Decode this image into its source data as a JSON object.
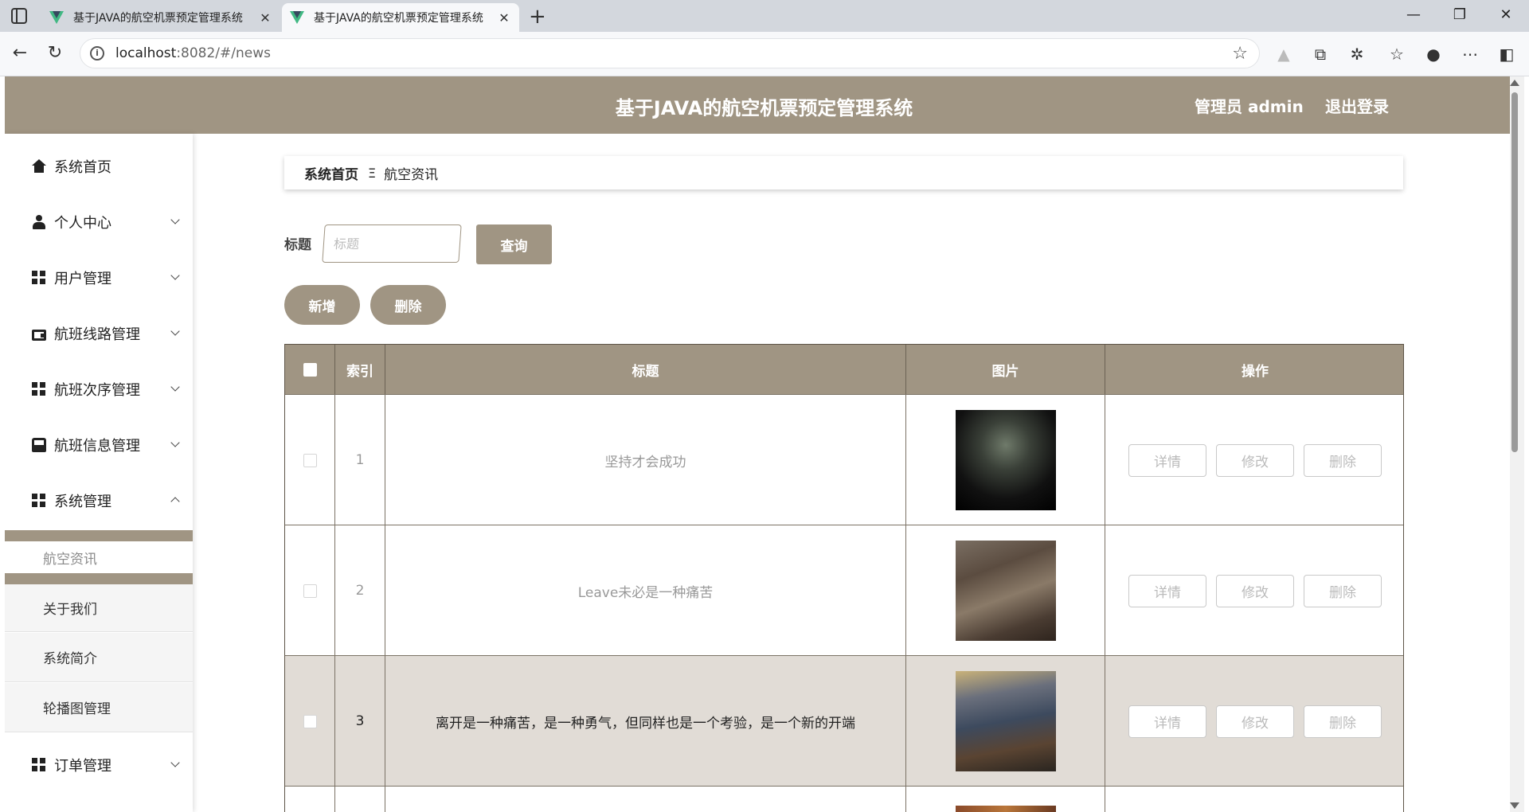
{
  "browser": {
    "tabs": [
      {
        "title": "基于JAVA的航空机票预定管理系统"
      },
      {
        "title": "基于JAVA的航空机票预定管理系统"
      }
    ],
    "url_host": "localhost",
    "url_rest": ":8082/#/news"
  },
  "header": {
    "title": "基于JAVA的航空机票预定管理系统",
    "admin": "管理员 admin",
    "logout": "退出登录"
  },
  "sidebar": {
    "items": [
      {
        "label": "系统首页",
        "icon": "home-icon"
      },
      {
        "label": "个人中心",
        "icon": "user-icon"
      },
      {
        "label": "用户管理",
        "icon": "grid-icon"
      },
      {
        "label": "航班线路管理",
        "icon": "wallet-icon"
      },
      {
        "label": "航班次序管理",
        "icon": "grid-icon"
      },
      {
        "label": "航班信息管理",
        "icon": "bus-icon"
      },
      {
        "label": "系统管理",
        "icon": "grid-icon"
      },
      {
        "label": "订单管理",
        "icon": "grid-icon"
      }
    ],
    "sub_items": [
      {
        "label": "航空资讯"
      },
      {
        "label": "关于我们"
      },
      {
        "label": "系统简介"
      },
      {
        "label": "轮播图管理"
      }
    ]
  },
  "breadcrumb": {
    "home": "系统首页",
    "separator": "Ξ",
    "current": "航空资讯"
  },
  "search": {
    "label": "标题",
    "placeholder": "标题",
    "query_button": "查询"
  },
  "actions": {
    "add": "新增",
    "delete": "删除"
  },
  "table": {
    "headers": {
      "index": "索引",
      "title": "标题",
      "image": "图片",
      "actions": "操作"
    },
    "rows": [
      {
        "index": "1",
        "title": "坚持才会成功"
      },
      {
        "index": "2",
        "title": "Leave未必是一种痛苦"
      },
      {
        "index": "3",
        "title": "离开是一种痛苦，是一种勇气，但同样也是一个考验，是一个新的开端"
      }
    ],
    "row_buttons": {
      "detail": "详情",
      "edit": "修改",
      "delete": "删除"
    }
  },
  "colors": {
    "accent": "#a09583",
    "row_highlight": "#e1dcd6"
  }
}
